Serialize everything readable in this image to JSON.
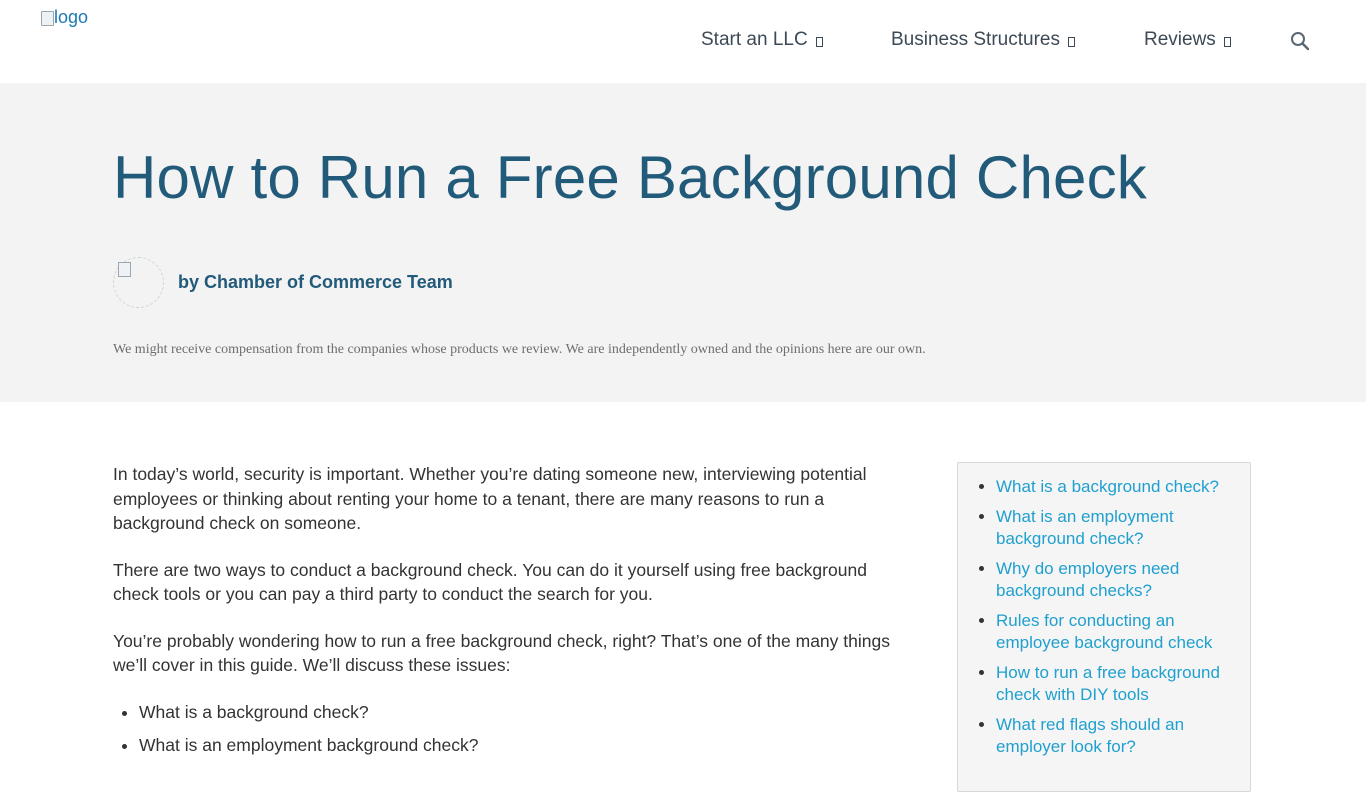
{
  "header": {
    "logo_text": "logo",
    "nav": [
      {
        "label": "Start an LLC"
      },
      {
        "label": "Business Structures"
      },
      {
        "label": "Reviews"
      }
    ],
    "search_icon": "search-icon"
  },
  "hero": {
    "title": "How to Run a Free Background Check",
    "author": "by Chamber of Commerce Team",
    "disclosure": "We might receive compensation from the companies whose products we review. We are independently owned and the opinions here are our own."
  },
  "article": {
    "paragraphs": [
      "In today’s world, security is important. Whether you’re dating someone new, interviewing potential employees or thinking about renting your home to a tenant, there are many reasons to run a background check on someone.",
      "There are two ways to conduct a background check. You can do it yourself using free background check tools or you can pay a third party to conduct the search for you.",
      "You’re probably wondering how to run a free background check, right? That’s one of the many things we’ll cover in this guide. We’ll discuss these issues:"
    ],
    "list": [
      "What is a background check?",
      "What is an employment background check?"
    ]
  },
  "toc": {
    "items": [
      "What is a background check?",
      "What is an employment background check?",
      "Why do employers need background checks?",
      "Rules for conducting an employee background check",
      "How to run a free background check with DIY tools",
      "What red flags should an employer look for?"
    ]
  }
}
